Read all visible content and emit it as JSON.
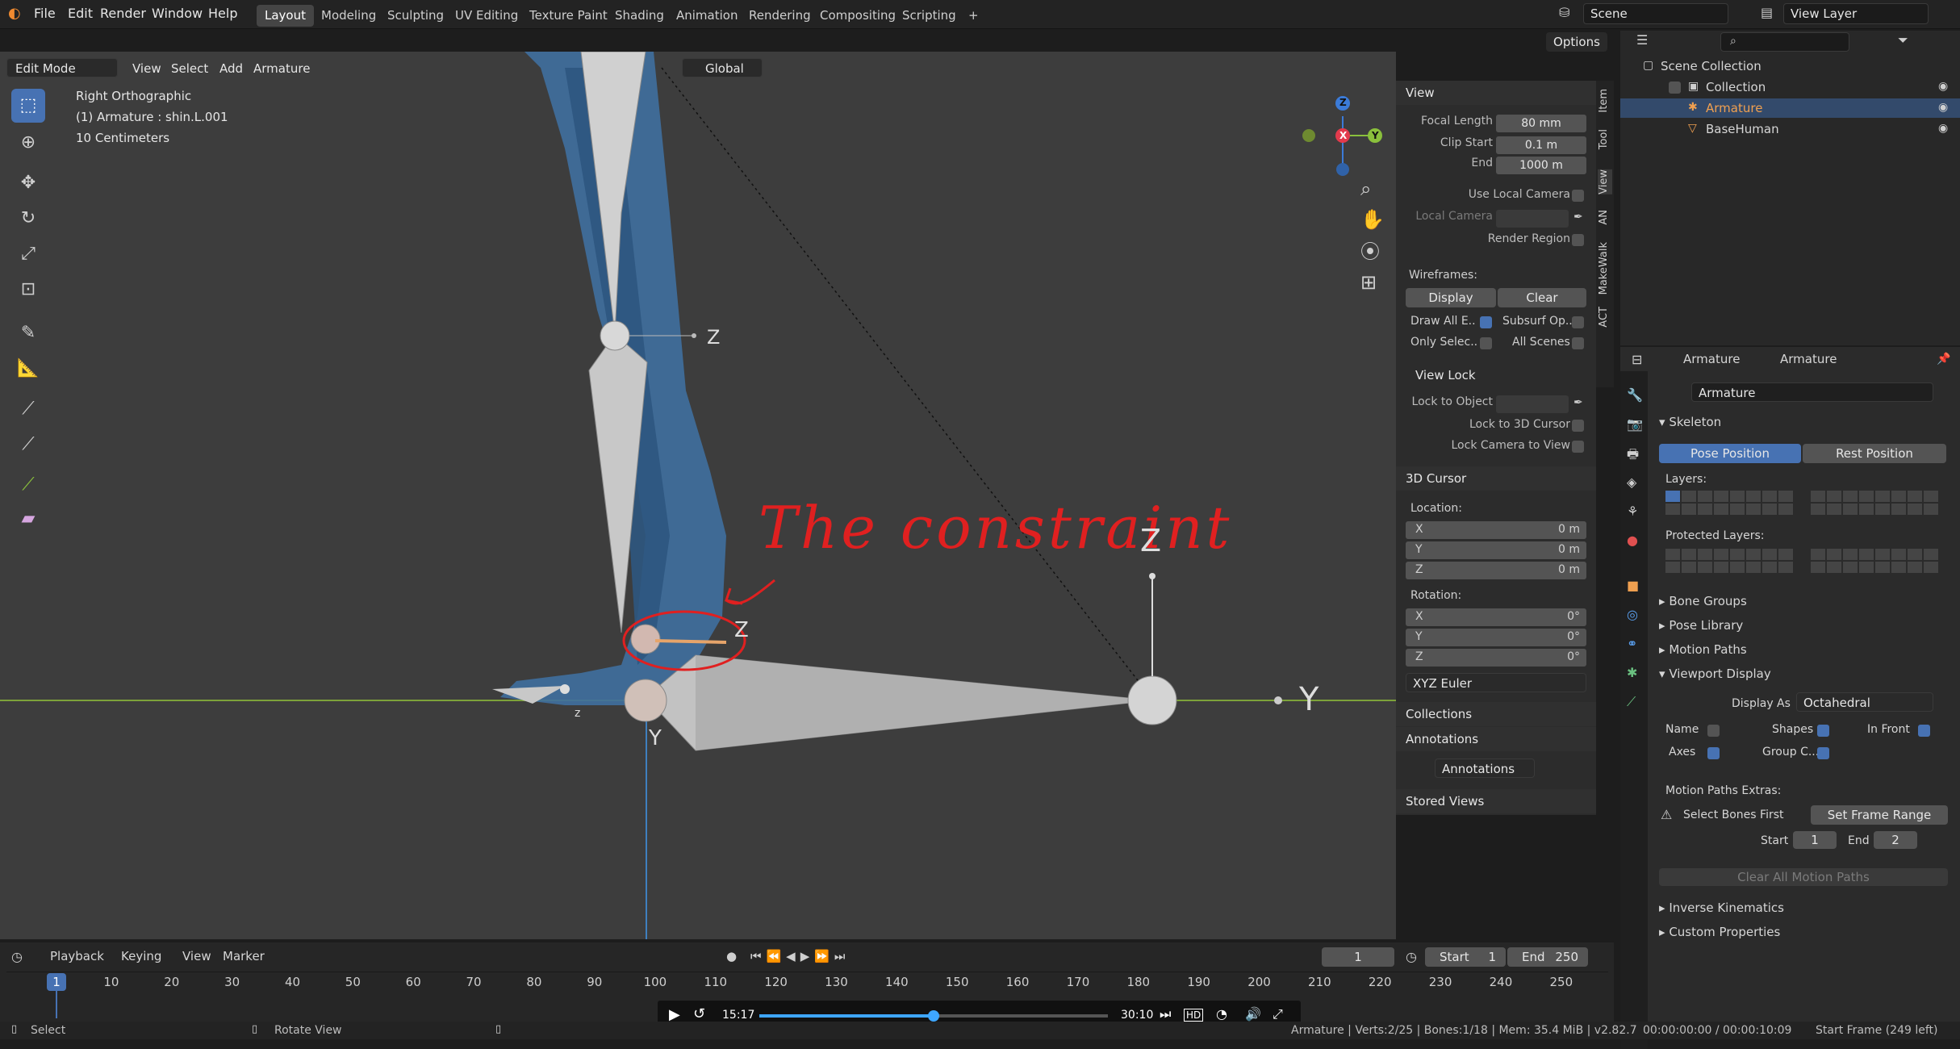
{
  "topbar": {
    "menus": [
      "File",
      "Edit",
      "Render",
      "Window",
      "Help"
    ],
    "workspaces": [
      "Layout",
      "Modeling",
      "Sculpting",
      "UV Editing",
      "Texture Paint",
      "Shading",
      "Animation",
      "Rendering",
      "Compositing",
      "Scripting"
    ],
    "active_workspace": "Layout",
    "add_tab": "+",
    "scene_name": "Scene",
    "view_layer": "View Layer"
  },
  "viewport_header": {
    "mode": "Edit Mode",
    "menus": [
      "View",
      "Select",
      "Add",
      "Armature"
    ],
    "transform_orientation": "Global",
    "options": "Options"
  },
  "viewport_overlay": {
    "view_name": "Right Orthographic",
    "object_info": "(1) Armature : shin.L.001",
    "scale": "10 Centimeters",
    "annotation_text": "The constraint",
    "axis_labels": {
      "z_top": "Z",
      "z_right": "Z",
      "y_bottom": "Y",
      "y_right": "Y",
      "z_small": "Z",
      "z_tiny": "z"
    }
  },
  "gizmo": {
    "z": "Z",
    "y": "Y",
    "x": "X"
  },
  "npanel": {
    "view_header": "View",
    "focal_length_label": "Focal Length",
    "focal_length": "80 mm",
    "clip_start_label": "Clip Start",
    "clip_start": "0.1 m",
    "end_label": "End",
    "clip_end": "1000 m",
    "use_local_camera": "Use Local Camera",
    "local_camera": "Local Camera",
    "render_region": "Render Region",
    "wireframes": "Wireframes:",
    "display": "Display",
    "clear": "Clear",
    "draw_all_edges": "Draw All E..",
    "subsurf": "Subsurf Op..",
    "only_selected": "Only Selec..",
    "all_scenes": "All Scenes",
    "view_lock_header": "View Lock",
    "lock_to_object": "Lock to Object",
    "lock_to_cursor": "Lock to 3D Cursor",
    "lock_camera": "Lock Camera to View",
    "cursor_header": "3D Cursor",
    "location_label": "Location:",
    "loc_x": "0 m",
    "loc_y": "0 m",
    "loc_z": "0 m",
    "rotation_label": "Rotation:",
    "rot_x": "0°",
    "rot_y": "0°",
    "rot_z": "0°",
    "x": "X",
    "y": "Y",
    "z": "Z",
    "rotation_mode": "XYZ Euler",
    "collections": "Collections",
    "annotations_header": "Annotations",
    "annotations_name": "Annotations",
    "stored_views": "Stored Views"
  },
  "side_tabs": [
    "Item",
    "Tool",
    "View",
    "AN",
    "MakeWalk",
    "ACT"
  ],
  "outliner": {
    "root": "Scene Collection",
    "collection": "Collection",
    "items": [
      "Armature",
      "BaseHuman"
    ]
  },
  "properties": {
    "breadcrumb_1": "Armature",
    "breadcrumb_2": "Armature",
    "datablock": "Armature",
    "skeleton": "Skeleton",
    "pose_position": "Pose Position",
    "rest_position": "Rest Position",
    "layers": "Layers:",
    "protected_layers": "Protected Layers:",
    "bone_groups": "Bone Groups",
    "pose_library": "Pose Library",
    "motion_paths": "Motion Paths",
    "viewport_display": "Viewport Display",
    "display_as_label": "Display As",
    "display_as": "Octahedral",
    "name": "Name",
    "shapes": "Shapes",
    "in_front": "In Front",
    "axes": "Axes",
    "group_colors": "Group C...",
    "motion_paths_extras": "Motion Paths Extras:",
    "select_bones_first": "Select Bones First",
    "set_frame_range": "Set Frame Range",
    "start_label": "Start",
    "start_val": "1",
    "end_label": "End",
    "end_val": "2",
    "clear_all_motion_paths": "Clear All Motion Paths",
    "inverse_kinematics": "Inverse Kinematics",
    "custom_properties": "Custom Properties"
  },
  "timeline": {
    "menus": [
      "Playback",
      "Keying",
      "View",
      "Marker"
    ],
    "current_frame": "1",
    "start_label": "Start",
    "start": "1",
    "end_label": "End",
    "end": "250",
    "ticks": [
      "1",
      "10",
      "20",
      "30",
      "40",
      "50",
      "60",
      "70",
      "80",
      "90",
      "100",
      "110",
      "120",
      "130",
      "140",
      "150",
      "160",
      "170",
      "180",
      "190",
      "200",
      "210",
      "220",
      "230",
      "240",
      "250"
    ]
  },
  "video": {
    "elapsed": "15:17",
    "total": "30:10",
    "progress": 0.5
  },
  "statusbar": {
    "select": "Select",
    "rotate_view": "Rotate View",
    "info": "Armature | Verts:2/25 | Bones:1/18 | Mem: 35.4 MiB | v2.82.7",
    "time": "00:00:00:00 / 00:00:10:09",
    "start_frame": "Start Frame (249 left)"
  },
  "colors": {
    "accent": "#4772b3",
    "mesh": "#3f6f9e",
    "viewport_bg": "#3d3d3d",
    "annotation": "#e02020"
  }
}
